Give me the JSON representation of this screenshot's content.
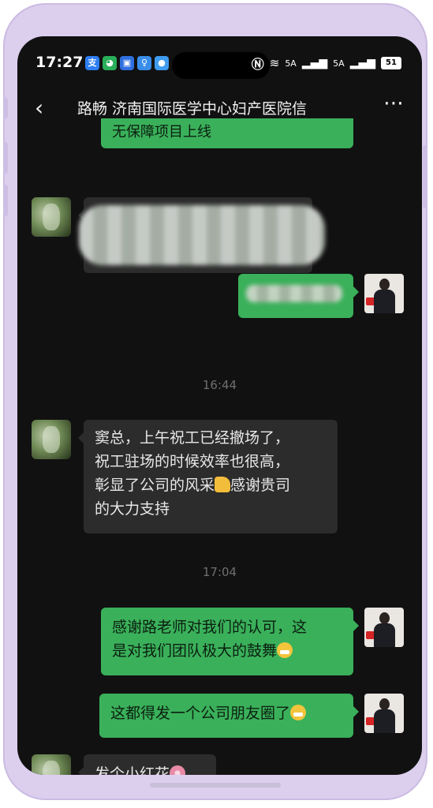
{
  "status_bar": {
    "time": "17:27",
    "net1": "5A",
    "net2": "5A",
    "battery": "51"
  },
  "header": {
    "back_label": "<",
    "title": "路畅 济南国际医学中心妇产医院信",
    "more_label": "⋯"
  },
  "messages": [
    {
      "id": "m0",
      "type": "out",
      "text": "无保障项目上线",
      "partial": true
    },
    {
      "id": "m1",
      "type": "in",
      "text": "",
      "blurred": true
    },
    {
      "id": "m2",
      "type": "out",
      "text": "",
      "blurred": true
    },
    {
      "id": "ts1",
      "type": "timestamp",
      "text": "16:44"
    },
    {
      "id": "m3",
      "type": "in",
      "lines": [
        "窦总，上午祝工已经撤场了，",
        "祝工驻场的时候效率也很高，",
        "彰显了公司的风采",
        "感谢贵司",
        "的大力支持"
      ],
      "emoji": "thumbs-up-icon"
    },
    {
      "id": "ts2",
      "type": "timestamp",
      "text": "17:04"
    },
    {
      "id": "m4",
      "type": "out",
      "lines": [
        "感谢路老师对我们的认可，这",
        "是对我们团队极大的鼓舞"
      ],
      "emoji": "grin-emoji-icon"
    },
    {
      "id": "m5",
      "type": "out",
      "text": "这都得发一个公司朋友圈了",
      "emoji": "grin-emoji-icon"
    },
    {
      "id": "m6",
      "type": "in",
      "text": "发个小红花",
      "emoji": "flower-emoji-icon"
    }
  ],
  "colors": {
    "out_bubble": "#3ab05a",
    "in_bubble": "#2c2c2c",
    "background": "#111111",
    "frame": "#dccfee"
  }
}
